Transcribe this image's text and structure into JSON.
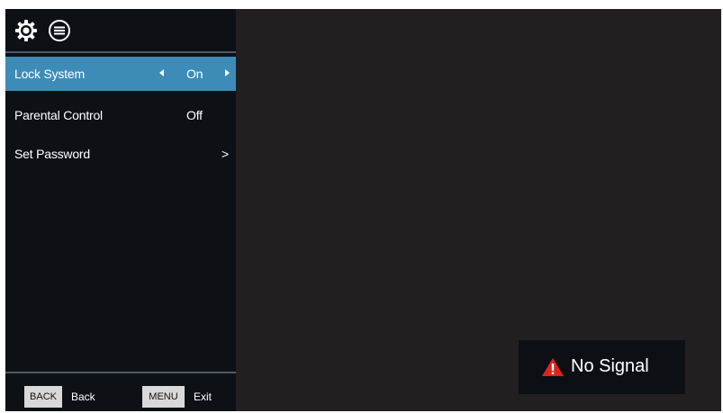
{
  "header": {
    "icons": [
      "gear-icon",
      "list-icon"
    ]
  },
  "menu": {
    "items": [
      {
        "label": "Lock System",
        "value": "On",
        "selected": true,
        "control": "left-right-arrows"
      },
      {
        "label": "Parental Control",
        "value": "Off",
        "selected": false,
        "control": "none"
      },
      {
        "label": "Set Password",
        "value": ">",
        "selected": false,
        "control": "chevron"
      }
    ]
  },
  "footer": {
    "back_key": "BACK",
    "back_label": "Back",
    "menu_key": "MENU",
    "menu_label": "Exit"
  },
  "status": {
    "message": "No Signal",
    "icon": "warning-icon"
  },
  "colors": {
    "screen_bg": "#231f20",
    "panel_bg": "#0d1116",
    "selected_bg": "#3d8cb8",
    "warning": "#e2231a"
  }
}
